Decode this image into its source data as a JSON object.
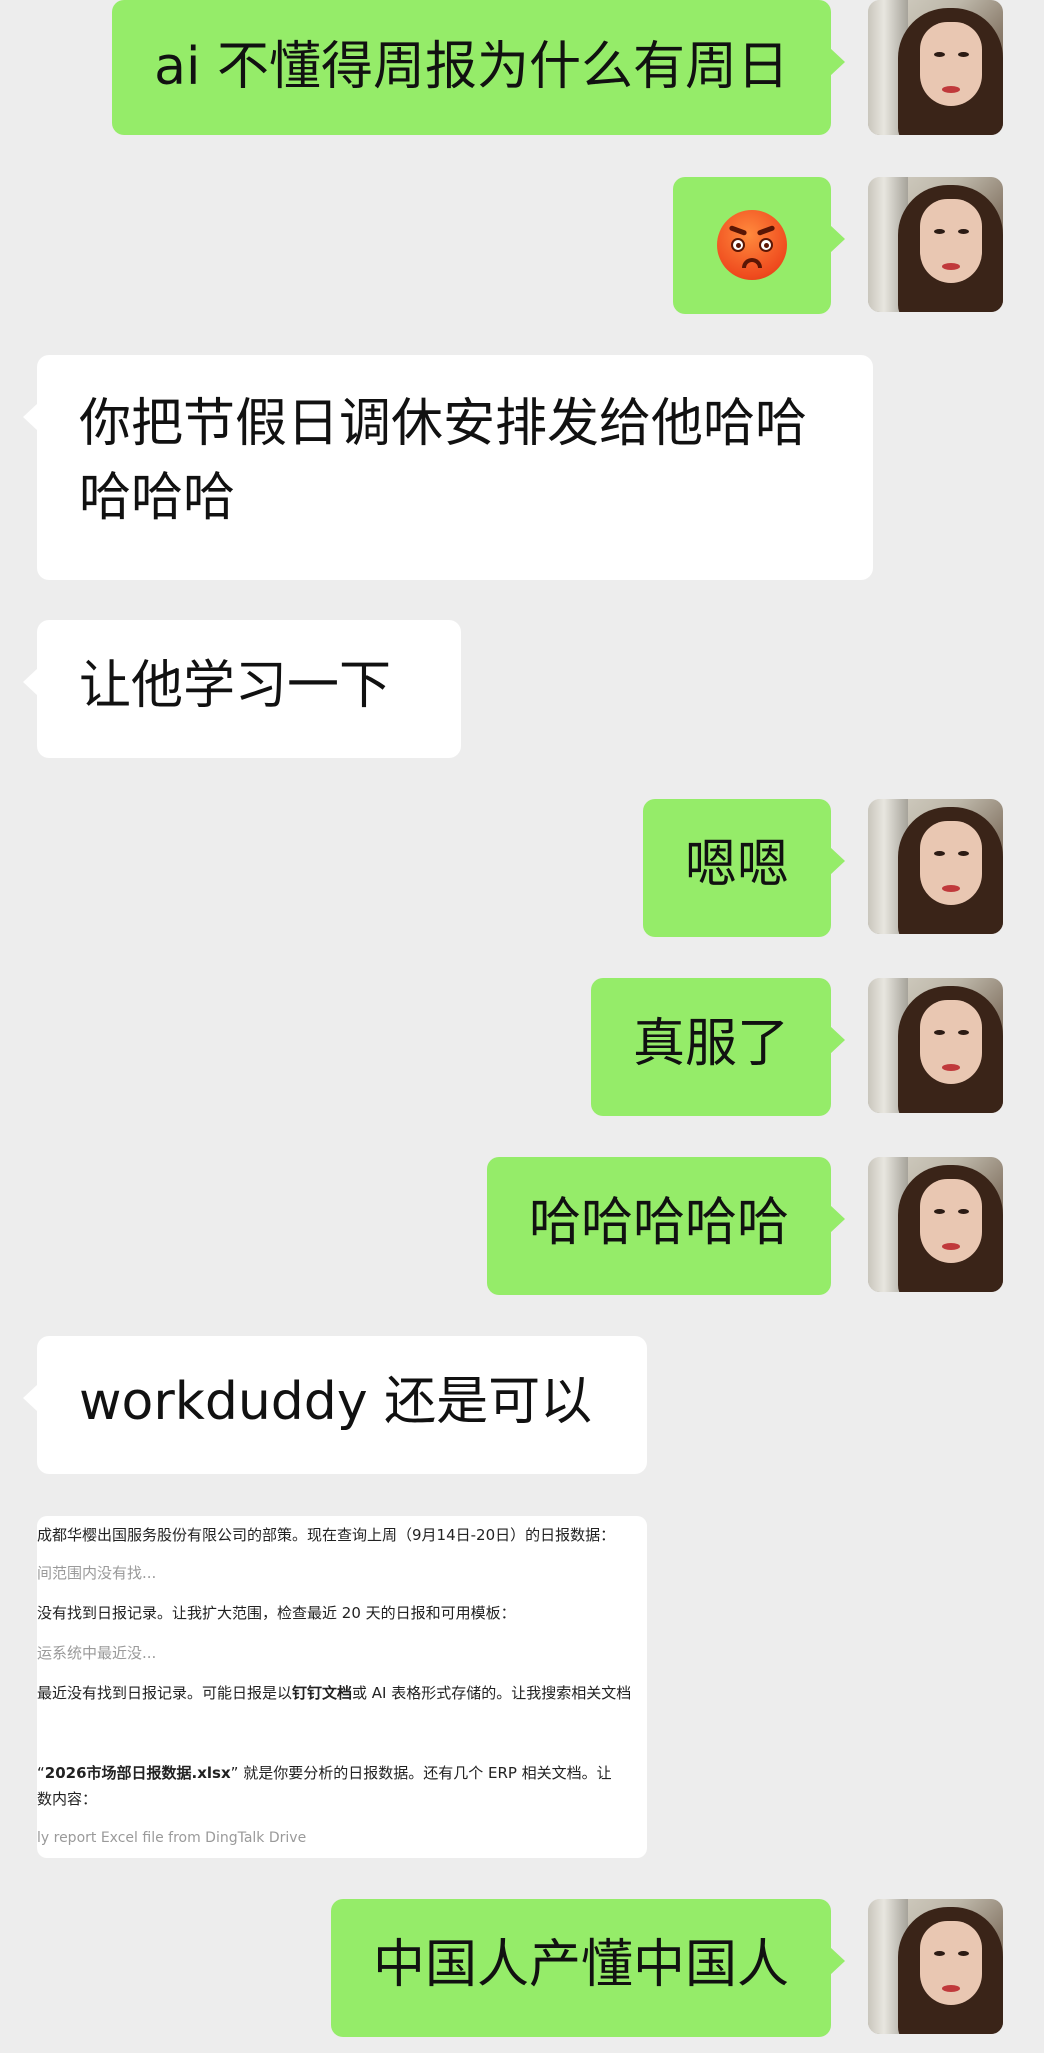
{
  "messages": [
    {
      "id": "m1",
      "side": "me",
      "text": "ai 不懂得周报为什么有周日"
    },
    {
      "id": "m2",
      "side": "me",
      "emoji": "pouting-angry-face"
    },
    {
      "id": "m3",
      "side": "them",
      "text": "你把节假日调休安排发给他哈哈哈哈哈"
    },
    {
      "id": "m4",
      "side": "them",
      "text": "让他学习一下"
    },
    {
      "id": "m5",
      "side": "me",
      "text": "嗯嗯"
    },
    {
      "id": "m6",
      "side": "me",
      "text": "真服了"
    },
    {
      "id": "m7",
      "side": "me",
      "text": "哈哈哈哈哈"
    },
    {
      "id": "m8",
      "side": "them",
      "text": "workduddy 还是可以"
    },
    {
      "id": "m10",
      "side": "me",
      "text": "中国人产懂中国人"
    }
  ],
  "shared_screenshot": {
    "lines": [
      {
        "pre": "成都华樱出国服务股份有限公司的部策。现在查询上周（9月14日-20日）的日报数据：",
        "bold": "",
        "post": ""
      },
      {
        "pre": "间范围内没有找...",
        "bold": "",
        "post": ""
      },
      {
        "pre": "没有找到日报记录。让我扩大范围，检查最近 20 天的日报和可用模板：",
        "bold": "",
        "post": ""
      },
      {
        "pre": "运系统中最近没...",
        "bold": "",
        "post": ""
      },
      {
        "pre": "最近没有找到日报记录。可能日报是以",
        "bold": "钉钉文档",
        "post": "或 AI 表格形式存储的。让我搜索相关文档"
      },
      {
        "pre": "“",
        "bold": "2026市场部日报数据.xlsx",
        "post": "” 就是你要分析的日报数据。还有几个 ERP 相关文档。让"
      },
      {
        "pre": "数内容：",
        "bold": "",
        "post": ""
      },
      {
        "pre": "ly report Excel file from DingTalk Drive",
        "bold": "",
        "post": ""
      }
    ]
  },
  "colors": {
    "background": "#ededed",
    "my_bubble": "#95ec69",
    "their_bubble": "#ffffff",
    "text": "#111111"
  },
  "watermark": ""
}
